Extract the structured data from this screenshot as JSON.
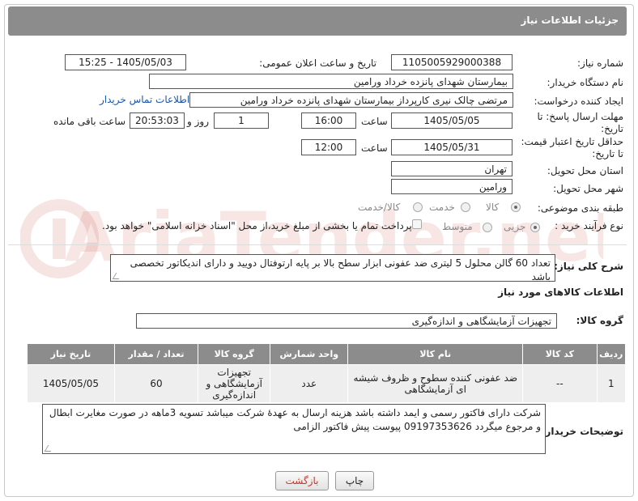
{
  "header": {
    "title": "جزئیات اطلاعات نیاز"
  },
  "fields": {
    "need_number_label": "شماره نیاز:",
    "need_number": "1105005929000388",
    "announce_label": "تاریخ و ساعت اعلان عمومی:",
    "announce_value": "1405/05/03 - 15:25",
    "buyer_org_label": "نام دستگاه خریدار:",
    "buyer_org": "بیمارستان شهدای پانزده خرداد ورامین",
    "creator_label": "ایجاد کننده درخواست:",
    "creator": "مرتضی چالک نیری کارپرداز بیمارستان شهدای پانزده خرداد ورامین",
    "contact_link": "اطلاعات تماس خریدار",
    "deadline_label_1": "مهلت ارسال پاسخ: تا",
    "deadline_label_2": "تاریخ:",
    "deadline_date": "1405/05/05",
    "time_label": "ساعت",
    "deadline_time": "16:00",
    "days_value": "1",
    "days_label": "روز و",
    "remaining_time": "20:53:03",
    "remaining_label": "ساعت باقی مانده",
    "validity_label_1": "حداقل تاریخ اعتبار قیمت:",
    "validity_label_2": "تا تاریخ:",
    "validity_date": "1405/05/31",
    "validity_time": "12:00",
    "province_label": "استان محل تحویل:",
    "province": "تهران",
    "city_label": "شهر محل تحویل:",
    "city": "ورامین",
    "category_label": "طبقه بندی موضوعی:",
    "category_options": [
      "کالا",
      "خدمت",
      "کالا/خدمت"
    ],
    "process_label": "نوع فرآیند خرید :",
    "process_options": [
      "جزیی",
      "متوسط"
    ],
    "payment_note": "پرداخت تمام یا بخشی از مبلغ خرید،از محل \"اسناد خزانه اسلامی\" خواهد بود."
  },
  "summary": {
    "label": "شرح کلی نیاز:",
    "text": "تعداد 60 گالن محلول 5 لیتری ضد عفونی ابزار سطح بالا بر پایه ارتوفتال دویید و دارای اندیکاتور تخصصی باشد"
  },
  "goods": {
    "section_title": "اطلاعات کالاهای مورد نیاز",
    "group_label": "گروه کالا:",
    "group_value": "تجهیزات آزمایشگاهی و اندازه‌گیری",
    "columns": [
      "ردیف",
      "کد کالا",
      "نام کالا",
      "واحد شمارش",
      "گروه کالا",
      "تعداد / مقدار",
      "تاریخ نیاز"
    ],
    "rows": [
      [
        "1",
        "--",
        "ضد عفونی کننده سطوح و ظروف شیشه ای آزمایشگاهی",
        "عدد",
        "تجهیزات آزمایشگاهی و اندازه‌گیری",
        "60",
        "1405/05/05"
      ]
    ]
  },
  "buyer_notes": {
    "label": "توضیحات خریدار:",
    "text": "شرکت دارای فاکتور رسمی و ایمد داشته باشد هزینه ارسال به عهدهٔ شرکت میباشد تسویه 3ماهه در صورت مغایرت ابطال و مرجوع میگردد 09197353626 پیوست پیش فاکتور الزامی"
  },
  "buttons": {
    "print": "چاپ",
    "back": "بازگشت"
  },
  "watermark": {
    "text": "AriaTender.net"
  },
  "colors": {
    "header_bg": "#8c8c8c",
    "back_text": "#c0392b",
    "link": "#1a55b0",
    "watermark": "#c0392b"
  }
}
